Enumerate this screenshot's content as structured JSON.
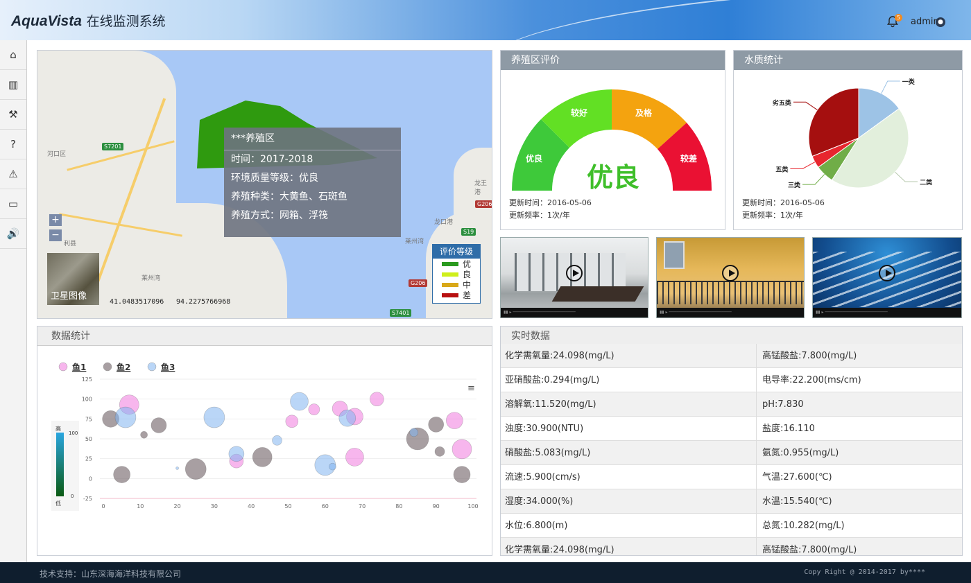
{
  "header": {
    "logo_en": "AquaVista",
    "logo_cn": "在线监测系统",
    "notif_count": "5",
    "user": "admin"
  },
  "sidebar": {
    "items": [
      {
        "icon": "home-icon",
        "glyph": "⌂"
      },
      {
        "icon": "bar-chart-icon",
        "glyph": "▥"
      },
      {
        "icon": "gavel-icon",
        "glyph": "⚒"
      },
      {
        "icon": "help-icon",
        "glyph": "?"
      },
      {
        "icon": "warning-icon",
        "glyph": "⚠"
      },
      {
        "icon": "laptop-icon",
        "glyph": "▭"
      },
      {
        "icon": "volume-icon",
        "glyph": "🔊"
      }
    ]
  },
  "map": {
    "popup": {
      "title": "***养殖区",
      "time": "时间：2017-2018",
      "quality": "环境质量等级：优良",
      "species": "养殖种类：大黄鱼、石斑鱼",
      "method": "养殖方式：网箱、浮筏"
    },
    "zoom_in": "+",
    "zoom_out": "−",
    "satellite": "卫星图像",
    "lat": "41.0483517096",
    "lon": "94.2275766968",
    "legend": {
      "title": "评价等级",
      "items": [
        {
          "label": "优",
          "color": "#2a9a1e"
        },
        {
          "label": "良",
          "color": "#cfef1b"
        },
        {
          "label": "中",
          "color": "#d9a818"
        },
        {
          "label": "差",
          "color": "#b81010"
        }
      ]
    },
    "labels": {
      "s7201": "S7201",
      "g206a": "G206",
      "g206b": "G206",
      "s19": "S19",
      "s7401": "S7401",
      "hekou": "河口区",
      "laizhou": "莱州湾",
      "laizhou2": "莱州湾",
      "longkou": "龙口港",
      "lizhi": "利县",
      "longx": "龙王港"
    }
  },
  "eval_panel": {
    "title": "养殖区评价",
    "grade": "优良",
    "segments": [
      "优良",
      "较好",
      "及格",
      "较差"
    ],
    "update_time": "更新时间：2016-05-06",
    "update_freq": "更新频率：1次/年"
  },
  "water_panel": {
    "title": "水质统计",
    "update_time": "更新时间：2016-05-06",
    "update_freq": "更新频率：1次/年",
    "pie": {
      "slices": [
        {
          "label": "一类",
          "value": 15,
          "color": "#9dc3e6"
        },
        {
          "label": "二类",
          "value": 44,
          "color": "#e2efdc"
        },
        {
          "label": "三类",
          "value": 6,
          "color": "#70ad47"
        },
        {
          "label": "五类",
          "value": 4,
          "color": "#e8262e"
        },
        {
          "label": "劣五类",
          "value": 31,
          "color": "#a50f0f"
        }
      ]
    }
  },
  "videos": [
    {
      "name": "server-room"
    },
    {
      "name": "building"
    },
    {
      "name": "fish"
    }
  ],
  "stats_panel": {
    "title": "数据统计",
    "menu": "≡",
    "scale_high": "高",
    "scale_low": "低",
    "scale_max": "100",
    "scale_min": "0"
  },
  "chart_data": {
    "type": "scatter",
    "series": [
      {
        "name": "鱼1",
        "color": "rgba(240,110,220,0.5)",
        "points": [
          [
            7,
            93,
            14
          ],
          [
            36,
            22,
            10
          ],
          [
            51,
            72,
            9
          ],
          [
            57,
            87,
            8
          ],
          [
            64,
            88,
            11
          ],
          [
            68,
            78,
            12
          ],
          [
            74,
            100,
            10
          ],
          [
            95,
            73,
            12
          ],
          [
            97,
            37,
            14
          ],
          [
            68,
            27,
            13
          ]
        ]
      },
      {
        "name": "鱼2",
        "color": "rgba(110,95,100,0.6)",
        "points": [
          [
            2,
            75,
            12
          ],
          [
            5,
            5,
            12
          ],
          [
            11,
            55,
            5
          ],
          [
            15,
            67,
            11
          ],
          [
            25,
            12,
            15
          ],
          [
            43,
            27,
            14
          ],
          [
            58,
            0,
            0
          ],
          [
            85,
            50,
            16
          ],
          [
            90,
            68,
            11
          ],
          [
            91,
            34,
            7
          ],
          [
            97,
            5,
            12
          ]
        ]
      },
      {
        "name": "鱼3",
        "color": "rgba(130,180,240,0.55)",
        "points": [
          [
            6,
            77,
            15
          ],
          [
            20,
            13,
            2
          ],
          [
            30,
            77,
            15
          ],
          [
            36,
            31,
            11
          ],
          [
            47,
            48,
            7
          ],
          [
            53,
            97,
            13
          ],
          [
            60,
            17,
            15
          ],
          [
            62,
            15,
            5
          ],
          [
            66,
            76,
            12
          ],
          [
            84,
            58,
            6
          ]
        ]
      }
    ],
    "xlim": [
      0,
      100
    ],
    "ylim": [
      -25,
      125
    ],
    "xticks": [
      0,
      10,
      20,
      30,
      40,
      50,
      60,
      70,
      80,
      90,
      100
    ],
    "yticks": [
      125,
      100,
      75,
      50,
      25,
      0,
      -25
    ]
  },
  "realtime": {
    "title": "实时数据",
    "rows": [
      [
        "化学需氧量:24.098(mg/L)",
        "高锰酸盐:7.800(mg/L)"
      ],
      [
        "亚硝酸盐:0.294(mg/L)",
        "电导率:22.200(ms/cm)"
      ],
      [
        "溶解氧:11.520(mg/L)",
        "pH:7.830"
      ],
      [
        "浊度:30.900(NTU)",
        "盐度:16.110"
      ],
      [
        "硝酸盐:5.083(mg/L)",
        "氨氮:0.955(mg/L)"
      ],
      [
        "流速:5.900(cm/s)",
        "气温:27.600(℃)"
      ],
      [
        "湿度:34.000(%)",
        "水温:15.540(℃)"
      ],
      [
        "水位:6.800(m)",
        "总氮:10.282(mg/L)"
      ],
      [
        "化学需氧量:24.098(mg/L)",
        "高锰酸盐:7.800(mg/L)"
      ]
    ]
  },
  "footer": {
    "support": "技术支持：山东深海海洋科技有限公司",
    "copyright": "Copy Right @ 2014-2017 by****"
  }
}
